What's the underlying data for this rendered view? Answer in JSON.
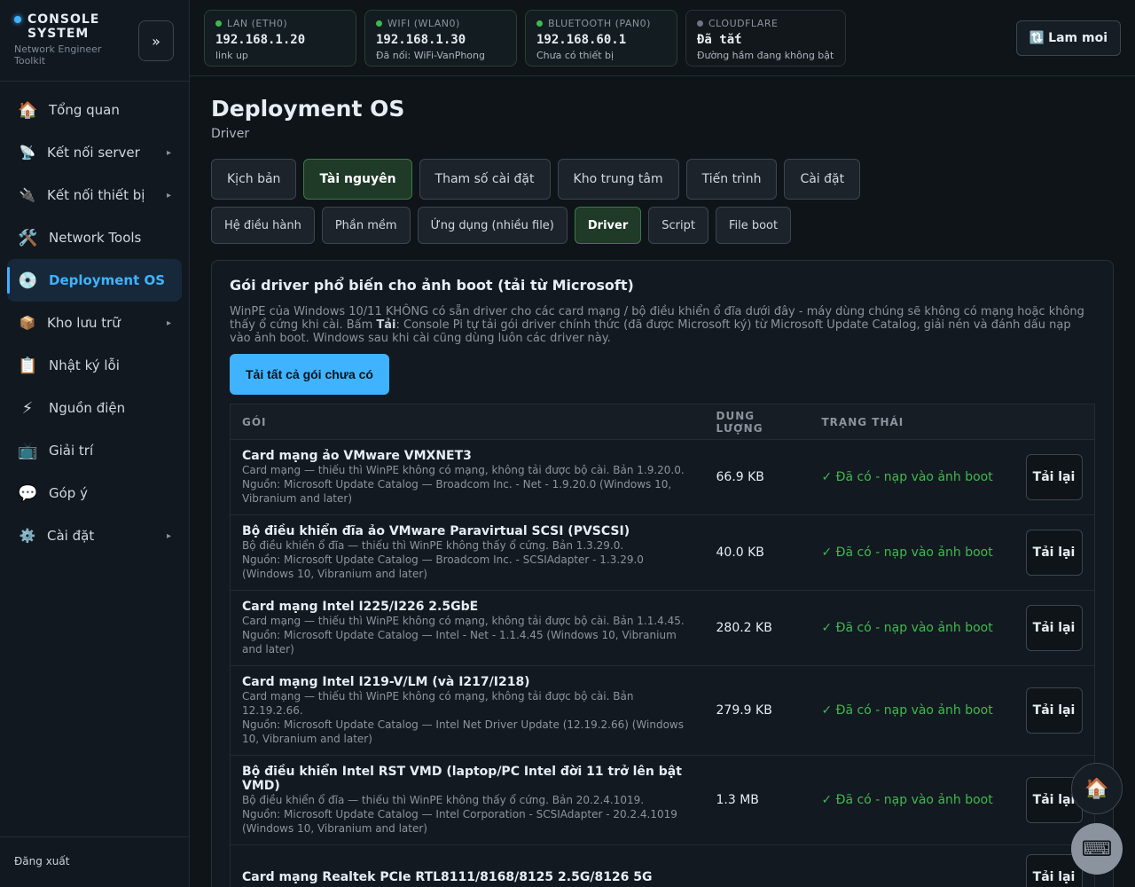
{
  "brand": {
    "title": "CONSOLE SYSTEM",
    "subtitle": "Network Engineer Toolkit",
    "collapse_icon": "»"
  },
  "sidebar": {
    "items": [
      {
        "label": "Tổng quan",
        "icon": "🏠",
        "name": "home-icon"
      },
      {
        "label": "Kết nối server",
        "icon": "📡",
        "name": "satellite-icon",
        "arrow": "▸"
      },
      {
        "label": "Kết nối thiết bị",
        "icon": "🔌",
        "name": "plug-icon",
        "arrow": "▸"
      },
      {
        "label": "Network Tools",
        "icon": "🛠️",
        "name": "tools-icon"
      },
      {
        "label": "Deployment OS",
        "icon": "💿",
        "name": "disc-icon",
        "active": true
      },
      {
        "label": "Kho lưu trữ",
        "icon": "📦",
        "name": "package-icon",
        "arrow": "▸"
      },
      {
        "label": "Nhật ký lỗi",
        "icon": "📋",
        "name": "clipboard-icon"
      },
      {
        "label": "Nguồn điện",
        "icon": "⚡",
        "name": "lightning-icon"
      },
      {
        "label": "Giải trí",
        "icon": "📺",
        "name": "tv-icon"
      },
      {
        "label": "Góp ý",
        "icon": "💬",
        "name": "speech-bubble-icon"
      },
      {
        "label": "Cài đặt",
        "icon": "⚙️",
        "name": "gear-icon",
        "arrow": "▸"
      }
    ],
    "logout": "Đăng xuất"
  },
  "topbar": {
    "cards": [
      {
        "label": "LAN (ETH0)",
        "value": "192.168.1.20",
        "note": "link up",
        "status": "up"
      },
      {
        "label": "WIFI (WLAN0)",
        "value": "192.168.1.30",
        "note": "Đã nối: WiFi-VanPhong",
        "status": "up"
      },
      {
        "label": "BLUETOOTH (PAN0)",
        "value": "192.168.60.1",
        "note": "Chưa có thiết bị",
        "status": "up"
      },
      {
        "label": "CLOUDFLARE",
        "value": "Đã tắt",
        "note": "Đường hầm đang không bật",
        "status": "off"
      }
    ],
    "refresh_icon": "🔃",
    "refresh_label": "Lam moi"
  },
  "page": {
    "title": "Deployment OS",
    "subtitle": "Driver"
  },
  "tabs": [
    "Kịch bản",
    "Tài nguyên",
    "Tham số cài đặt",
    "Kho trung tâm",
    "Tiến trình",
    "Cài đặt"
  ],
  "active_tab": 1,
  "subtabs": [
    "Hệ điều hành",
    "Phần mềm",
    "Ứng dụng (nhiều file)",
    "Driver",
    "Script",
    "File boot"
  ],
  "active_subtab": 3,
  "panel": {
    "title": "Gói driver phổ biến cho ảnh boot (tải từ Microsoft)",
    "desc_before": "WinPE của Windows 10/11 KHÔNG có sẵn driver cho các card mạng / bộ điều khiển ổ đĩa dưới đây - máy dùng chúng sẽ không có mạng hoặc không thấy ổ cứng khi cài. Bấm ",
    "desc_bold": "Tải",
    "desc_after": ": Console Pi tự tải gói driver chính thức (đã được Microsoft ký) từ Microsoft Update Catalog, giải nén và đánh dấu nạp vào ảnh boot. Windows sau khi cài cũng dùng luôn các driver này.",
    "download_all": "Tải tất cả gói chưa có"
  },
  "table": {
    "headers": [
      "GÓI",
      "DUNG LƯỢNG",
      "TRẠNG THÁI",
      ""
    ],
    "rows": [
      {
        "name": "Card mạng ảo VMware VMXNET3",
        "desc": "Card mạng — thiếu thì WinPE không có mạng, không tải được bộ cài. Bản 1.9.20.0.",
        "source": "Nguồn: Microsoft Update Catalog — Broadcom Inc. - Net - 1.9.20.0 (Windows 10, Vibranium and later)",
        "size": "66.9 KB",
        "status": "✓ Đã có - nạp vào ảnh boot",
        "action": "Tải lại"
      },
      {
        "name": "Bộ điều khiển đĩa ảo VMware Paravirtual SCSI (PVSCSI)",
        "desc": "Bộ điều khiển ổ đĩa — thiếu thì WinPE không thấy ổ cứng. Bản 1.3.29.0.",
        "source": "Nguồn: Microsoft Update Catalog — Broadcom Inc. - SCSIAdapter - 1.3.29.0 (Windows 10, Vibranium and later)",
        "size": "40.0 KB",
        "status": "✓ Đã có - nạp vào ảnh boot",
        "action": "Tải lại"
      },
      {
        "name": "Card mạng Intel I225/I226 2.5GbE",
        "desc": "Card mạng — thiếu thì WinPE không có mạng, không tải được bộ cài. Bản 1.1.4.45.",
        "source": "Nguồn: Microsoft Update Catalog — Intel - Net - 1.1.4.45 (Windows 10, Vibranium and later)",
        "size": "280.2 KB",
        "status": "✓ Đã có - nạp vào ảnh boot",
        "action": "Tải lại"
      },
      {
        "name": "Card mạng Intel I219-V/LM (và I217/I218)",
        "desc": "Card mạng — thiếu thì WinPE không có mạng, không tải được bộ cài. Bản 12.19.2.66.",
        "source": "Nguồn: Microsoft Update Catalog — Intel Net Driver Update (12.19.2.66) (Windows 10, Vibranium and later)",
        "size": "279.9 KB",
        "status": "✓ Đã có - nạp vào ảnh boot",
        "action": "Tải lại"
      },
      {
        "name": "Bộ điều khiển Intel RST VMD (laptop/PC Intel đời 11 trở lên bật VMD)",
        "desc": "Bộ điều khiển ổ đĩa — thiếu thì WinPE không thấy ổ cứng. Bản 20.2.4.1019.",
        "source": "Nguồn: Microsoft Update Catalog — Intel Corporation - SCSIAdapter - 20.2.4.1019 (Windows 10, Vibranium and later)",
        "size": "1.3 MB",
        "status": "✓ Đã có - nạp vào ảnh boot",
        "action": "Tải lại"
      },
      {
        "name": "Card mạng Realtek PCIe RTL8111/8168/8125 2.5G/8126 5G",
        "desc": "",
        "source": "",
        "size": "",
        "status": "",
        "action": "Tải lại"
      }
    ]
  },
  "fab": {
    "home_icon": "🏠",
    "keyboard_icon": "⌨"
  }
}
